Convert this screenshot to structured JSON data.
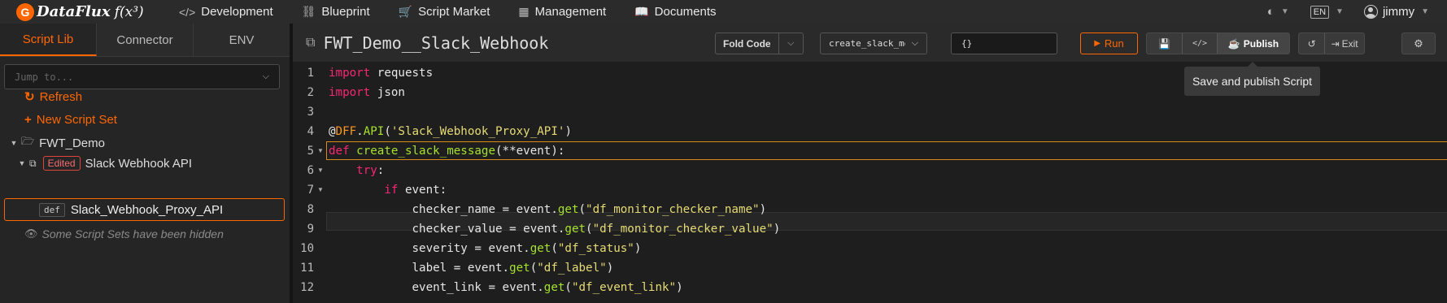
{
  "app": {
    "logo_mark": "G",
    "logo_text": "DataFlux",
    "logo_fx": "f(x³)"
  },
  "nav": {
    "items": [
      {
        "label": "Development",
        "icon": "code-icon",
        "glyph": "</>"
      },
      {
        "label": "Blueprint",
        "icon": "blueprint-icon",
        "glyph": "⛓"
      },
      {
        "label": "Script Market",
        "icon": "cart-icon",
        "glyph": "🛒"
      },
      {
        "label": "Management",
        "icon": "grid-icon",
        "glyph": "▦"
      },
      {
        "label": "Documents",
        "icon": "book-icon",
        "glyph": "📖"
      }
    ],
    "theme_glyph": "◐",
    "lang": "EN",
    "username": "jimmy"
  },
  "sidebar": {
    "tabs": [
      "Script Lib",
      "Connector",
      "ENV"
    ],
    "jump_placeholder": "Jump to...",
    "refresh_label": "Refresh",
    "new_set_label": "New Script Set",
    "tree": {
      "folder": "FWT_Demo",
      "script_badge": "Edited",
      "script": "Slack Webhook API",
      "func_badge": "def",
      "func": "Slack_Webhook_Proxy_API",
      "hidden_note": "Some Script Sets have been hidden"
    }
  },
  "editor": {
    "title": "FWT_Demo__Slack_Webhook",
    "fold_code_label": "Fold Code",
    "func_select": "create_slack_message",
    "args_value": "{}",
    "run_label": "Run",
    "publish_label": "Publish",
    "exit_label": "Exit",
    "tooltip": "Save and publish Script"
  },
  "code": {
    "lines": [
      {
        "n": "1",
        "fold": false
      },
      {
        "n": "2",
        "fold": false
      },
      {
        "n": "3",
        "fold": false
      },
      {
        "n": "4",
        "fold": false
      },
      {
        "n": "5",
        "fold": true
      },
      {
        "n": "6",
        "fold": true
      },
      {
        "n": "7",
        "fold": true
      },
      {
        "n": "8",
        "fold": false
      },
      {
        "n": "9",
        "fold": false
      },
      {
        "n": "10",
        "fold": false
      },
      {
        "n": "11",
        "fold": false
      },
      {
        "n": "12",
        "fold": false
      }
    ],
    "text": {
      "l1_kw": "import",
      "l1_rest": " requests",
      "l2_kw": "import",
      "l2_rest": " json",
      "l4_at": "@",
      "l4_dff": "DFF",
      "l4_dot": ".",
      "l4_api": "API",
      "l4_open": "(",
      "l4_str": "'Slack_Webhook_Proxy_API'",
      "l4_close": ")",
      "l5_kw": "def",
      "l5_fn": "create_slack_message",
      "l5_rest": "(**event):",
      "l6_kw": "try",
      "l6_rest": ":",
      "l7_kw": "if",
      "l7_rest": " event:",
      "l8_a": "checker_name = event.",
      "l8_get": "get",
      "l8_b": "(",
      "l8_str": "\"df_monitor_checker_name\"",
      "l8_c": ")",
      "l9_a": "checker_value = event.",
      "l9_get": "get",
      "l9_b": "(",
      "l9_str": "\"df_monitor_checker_value\"",
      "l9_c": ")",
      "l10_a": "severity = event.",
      "l10_get": "get",
      "l10_b": "(",
      "l10_str": "\"df_status\"",
      "l10_c": ")",
      "l11_a": "label = event.",
      "l11_get": "get",
      "l11_b": "(",
      "l11_str": "\"df_label\"",
      "l11_c": ")",
      "l12_a": "event_link = event.",
      "l12_get": "get",
      "l12_b": "(",
      "l12_str": "\"df_event_link\"",
      "l12_c": ")"
    }
  },
  "colors": {
    "accent": "#ff6600",
    "keyword": "#f92672",
    "decorator": "#fd971f",
    "function": "#a6e22e",
    "string": "#e6db74"
  }
}
